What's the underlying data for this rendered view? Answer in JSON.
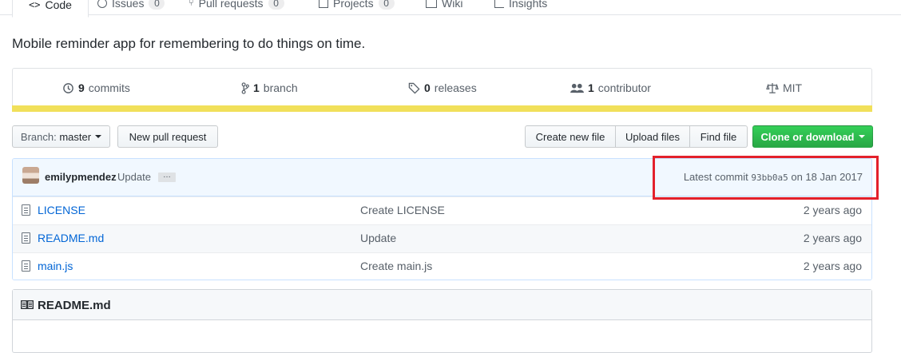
{
  "tabs": [
    {
      "label": "Code",
      "icon": "code-icon"
    },
    {
      "label": "Issues",
      "count": "0",
      "icon": "issue-icon"
    },
    {
      "label": "Pull requests",
      "count": "0",
      "icon": "pull-request-icon"
    },
    {
      "label": "Projects",
      "count": "0",
      "icon": "project-icon"
    },
    {
      "label": "Wiki",
      "icon": "wiki-icon"
    },
    {
      "label": "Insights",
      "icon": "graph-icon"
    }
  ],
  "description": "Mobile reminder app for remembering to do things on time.",
  "stats": {
    "commits": {
      "count": "9",
      "label": "commits"
    },
    "branches": {
      "count": "1",
      "label": "branch"
    },
    "releases": {
      "count": "0",
      "label": "releases"
    },
    "contributors": {
      "count": "1",
      "label": "contributor"
    },
    "license": "MIT"
  },
  "language_bar_color": "#f1e05a",
  "toolbar": {
    "branch_prefix": "Branch:",
    "branch_name": "master",
    "new_pr": "New pull request",
    "create_file": "Create new file",
    "upload_files": "Upload files",
    "find_file": "Find file",
    "clone": "Clone or download"
  },
  "latest_commit": {
    "author": "emilypmendez",
    "message": "Update",
    "ellipsis": "…",
    "prefix": "Latest commit",
    "sha": "93bb0a5",
    "date_text": "on 18 Jan 2017"
  },
  "files": [
    {
      "name": "LICENSE",
      "message": "Create LICENSE",
      "age": "2 years ago"
    },
    {
      "name": "README.md",
      "message": "Update",
      "age": "2 years ago"
    },
    {
      "name": "main.js",
      "message": "Create main.js",
      "age": "2 years ago"
    }
  ],
  "readme": {
    "title": "README.md"
  },
  "colors": {
    "link": "#0366d6",
    "highlight": "#e3212b",
    "green": "#28a745"
  }
}
